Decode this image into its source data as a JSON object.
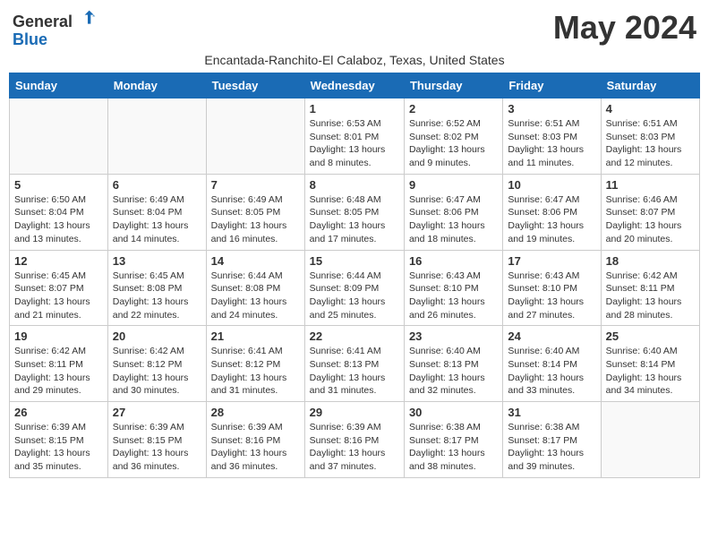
{
  "header": {
    "logo_general": "General",
    "logo_blue": "Blue",
    "month_title": "May 2024",
    "subtitle": "Encantada-Ranchito-El Calaboz, Texas, United States"
  },
  "days_of_week": [
    "Sunday",
    "Monday",
    "Tuesday",
    "Wednesday",
    "Thursday",
    "Friday",
    "Saturday"
  ],
  "weeks": [
    [
      {
        "day": "",
        "info": ""
      },
      {
        "day": "",
        "info": ""
      },
      {
        "day": "",
        "info": ""
      },
      {
        "day": "1",
        "info": "Sunrise: 6:53 AM\nSunset: 8:01 PM\nDaylight: 13 hours and 8 minutes."
      },
      {
        "day": "2",
        "info": "Sunrise: 6:52 AM\nSunset: 8:02 PM\nDaylight: 13 hours and 9 minutes."
      },
      {
        "day": "3",
        "info": "Sunrise: 6:51 AM\nSunset: 8:03 PM\nDaylight: 13 hours and 11 minutes."
      },
      {
        "day": "4",
        "info": "Sunrise: 6:51 AM\nSunset: 8:03 PM\nDaylight: 13 hours and 12 minutes."
      }
    ],
    [
      {
        "day": "5",
        "info": "Sunrise: 6:50 AM\nSunset: 8:04 PM\nDaylight: 13 hours and 13 minutes."
      },
      {
        "day": "6",
        "info": "Sunrise: 6:49 AM\nSunset: 8:04 PM\nDaylight: 13 hours and 14 minutes."
      },
      {
        "day": "7",
        "info": "Sunrise: 6:49 AM\nSunset: 8:05 PM\nDaylight: 13 hours and 16 minutes."
      },
      {
        "day": "8",
        "info": "Sunrise: 6:48 AM\nSunset: 8:05 PM\nDaylight: 13 hours and 17 minutes."
      },
      {
        "day": "9",
        "info": "Sunrise: 6:47 AM\nSunset: 8:06 PM\nDaylight: 13 hours and 18 minutes."
      },
      {
        "day": "10",
        "info": "Sunrise: 6:47 AM\nSunset: 8:06 PM\nDaylight: 13 hours and 19 minutes."
      },
      {
        "day": "11",
        "info": "Sunrise: 6:46 AM\nSunset: 8:07 PM\nDaylight: 13 hours and 20 minutes."
      }
    ],
    [
      {
        "day": "12",
        "info": "Sunrise: 6:45 AM\nSunset: 8:07 PM\nDaylight: 13 hours and 21 minutes."
      },
      {
        "day": "13",
        "info": "Sunrise: 6:45 AM\nSunset: 8:08 PM\nDaylight: 13 hours and 22 minutes."
      },
      {
        "day": "14",
        "info": "Sunrise: 6:44 AM\nSunset: 8:08 PM\nDaylight: 13 hours and 24 minutes."
      },
      {
        "day": "15",
        "info": "Sunrise: 6:44 AM\nSunset: 8:09 PM\nDaylight: 13 hours and 25 minutes."
      },
      {
        "day": "16",
        "info": "Sunrise: 6:43 AM\nSunset: 8:10 PM\nDaylight: 13 hours and 26 minutes."
      },
      {
        "day": "17",
        "info": "Sunrise: 6:43 AM\nSunset: 8:10 PM\nDaylight: 13 hours and 27 minutes."
      },
      {
        "day": "18",
        "info": "Sunrise: 6:42 AM\nSunset: 8:11 PM\nDaylight: 13 hours and 28 minutes."
      }
    ],
    [
      {
        "day": "19",
        "info": "Sunrise: 6:42 AM\nSunset: 8:11 PM\nDaylight: 13 hours and 29 minutes."
      },
      {
        "day": "20",
        "info": "Sunrise: 6:42 AM\nSunset: 8:12 PM\nDaylight: 13 hours and 30 minutes."
      },
      {
        "day": "21",
        "info": "Sunrise: 6:41 AM\nSunset: 8:12 PM\nDaylight: 13 hours and 31 minutes."
      },
      {
        "day": "22",
        "info": "Sunrise: 6:41 AM\nSunset: 8:13 PM\nDaylight: 13 hours and 31 minutes."
      },
      {
        "day": "23",
        "info": "Sunrise: 6:40 AM\nSunset: 8:13 PM\nDaylight: 13 hours and 32 minutes."
      },
      {
        "day": "24",
        "info": "Sunrise: 6:40 AM\nSunset: 8:14 PM\nDaylight: 13 hours and 33 minutes."
      },
      {
        "day": "25",
        "info": "Sunrise: 6:40 AM\nSunset: 8:14 PM\nDaylight: 13 hours and 34 minutes."
      }
    ],
    [
      {
        "day": "26",
        "info": "Sunrise: 6:39 AM\nSunset: 8:15 PM\nDaylight: 13 hours and 35 minutes."
      },
      {
        "day": "27",
        "info": "Sunrise: 6:39 AM\nSunset: 8:15 PM\nDaylight: 13 hours and 36 minutes."
      },
      {
        "day": "28",
        "info": "Sunrise: 6:39 AM\nSunset: 8:16 PM\nDaylight: 13 hours and 36 minutes."
      },
      {
        "day": "29",
        "info": "Sunrise: 6:39 AM\nSunset: 8:16 PM\nDaylight: 13 hours and 37 minutes."
      },
      {
        "day": "30",
        "info": "Sunrise: 6:38 AM\nSunset: 8:17 PM\nDaylight: 13 hours and 38 minutes."
      },
      {
        "day": "31",
        "info": "Sunrise: 6:38 AM\nSunset: 8:17 PM\nDaylight: 13 hours and 39 minutes."
      },
      {
        "day": "",
        "info": ""
      }
    ]
  ]
}
